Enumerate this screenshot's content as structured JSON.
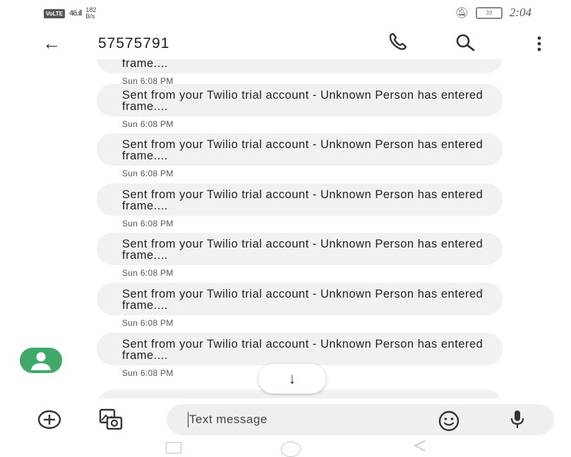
{
  "status_bar": {
    "network_badge": "VoLTE",
    "signal": "46.ıll",
    "speed_value": "182",
    "speed_unit": "B/s",
    "time": "2:04",
    "battery": "39"
  },
  "app_bar": {
    "title": "57575791",
    "back_icon": "arrow-left-icon",
    "call_icon": "phone-icon",
    "search_icon": "search-icon",
    "more_icon": "more-vert-icon"
  },
  "messages": [
    {
      "text": "frame....",
      "time": "Sun 6:08 PM"
    },
    {
      "text": "Sent from your Twilio trial account - Unknown Person has entered frame....",
      "time": "Sun 6:08 PM"
    },
    {
      "text": "Sent from your Twilio trial account - Unknown Person has entered frame....",
      "time": "Sun 6:08 PM"
    },
    {
      "text": "Sent from your Twilio trial account - Unknown Person has entered frame....",
      "time": "Sun 6:08 PM"
    },
    {
      "text": "Sent from your Twilio trial account - Unknown Person has entered frame....",
      "time": "Sun 6:08 PM"
    },
    {
      "text": "Sent from your Twilio trial account - Unknown Person has entered frame....",
      "time": "Sun 6:08 PM"
    },
    {
      "text": "Sent from your Twilio trial account - Unknown Person has entered frame....",
      "time": "Sun 6:08 PM"
    }
  ],
  "composer": {
    "placeholder": "Text message"
  },
  "colors": {
    "avatar": "#3fa96a",
    "bubble": "#f1f1f1",
    "input_bg": "#efefef"
  }
}
